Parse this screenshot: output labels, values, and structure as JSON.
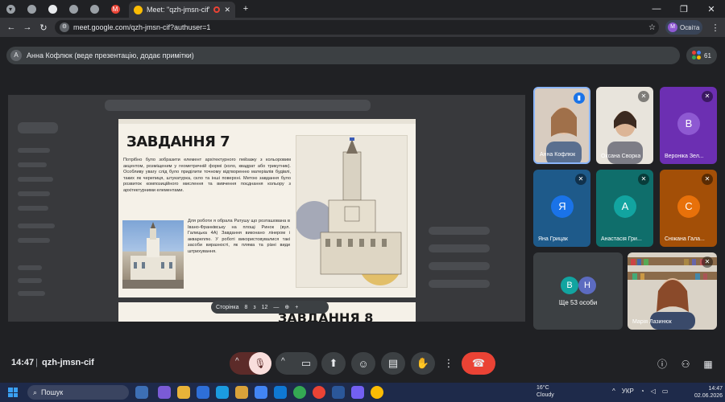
{
  "browser": {
    "tab_title": "Meet: \"qzh-jmsn-cif\"",
    "url": "meet.google.com/qzh-jmsn-cif?authuser=1",
    "profile_label": "Освіта",
    "profile_initial": "M"
  },
  "presenter_bar": {
    "text": "Анна Кофлюк (веде презентацію, додає примітки)",
    "avatar_initial": "A",
    "people_count": "61"
  },
  "slide": {
    "title": "ЗАВДАННЯ 7",
    "paragraph1": "Потрібно було зобразити елемент архітектурного пейзажу з кольоровим акцентом, розміщеним у геометричній формі (коло, квадрат або трикутник). Особливу увагу слід було приділити точному відтворенню матеріалів будівлі, таких як черепиця, штукатурка, скло та інші поверхні. Метою завдання було розвиток композиційного мислення та вивчення поєднання кольору з архітектурними елементами.",
    "paragraph2": "Для роботи я обрала Ратушу що розташована в Івано-Франківську на площі Ринок (вул. Галицька 4А) Завдання виконано лінером і аквареллю. У роботі використовувалися такі засоби виразності, як пляма та різні види штрихування.",
    "next_title": "ЗАВДАННЯ 8",
    "toolbar_page_label": "Сторінка",
    "toolbar_page": "8",
    "toolbar_sep": "з",
    "toolbar_total": "12"
  },
  "participants": [
    {
      "name": "Анна Кофлюк",
      "type": "video",
      "initial": ""
    },
    {
      "name": "Оксана Сворка",
      "type": "video",
      "initial": ""
    },
    {
      "name": "Вероніка Зел...",
      "type": "avatar",
      "initial": "В",
      "color": "#8e59d2"
    },
    {
      "name": "Яна Грицак",
      "type": "avatar",
      "initial": "Я",
      "color": "#1a73e8"
    },
    {
      "name": "Анастасія Гри...",
      "type": "avatar",
      "initial": "А",
      "color": "#12a4a0"
    },
    {
      "name": "Сніжана Гала...",
      "type": "avatar",
      "initial": "С",
      "color": "#e8710a"
    },
    {
      "name": "Ще 53 особи",
      "type": "others",
      "initials": [
        "В",
        "Н"
      ]
    },
    {
      "name": "Марія Лазинюк",
      "type": "video",
      "initial": ""
    }
  ],
  "meeting": {
    "time": "14:47",
    "code": "qzh-jmsn-cif"
  },
  "taskbar": {
    "search_placeholder": "Пошук",
    "weather_temp": "16°C",
    "weather_desc": "Cloudy",
    "lang": "УКР",
    "clock_time": "14:47",
    "clock_date": "02.06.2026"
  },
  "colors": {
    "end_call": "#ea4335",
    "mic_off": "#f28b82",
    "accent": "#8ab4f8"
  }
}
